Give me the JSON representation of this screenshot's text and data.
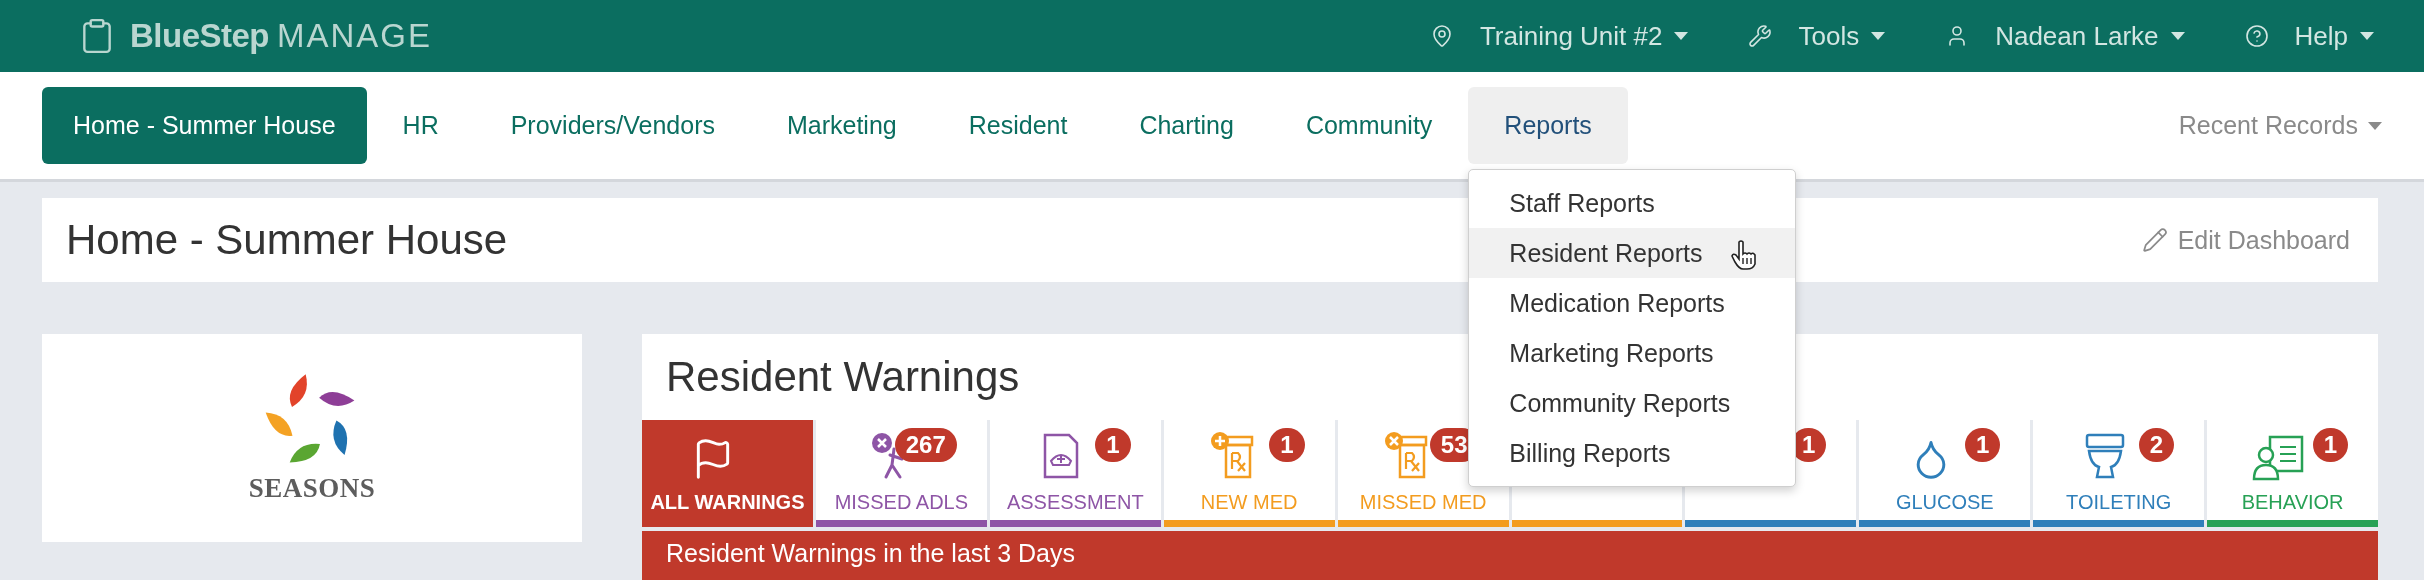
{
  "top_bar": {
    "brand": "BlueStep",
    "product": "MANAGE",
    "menus": [
      {
        "label": "Training Unit #2",
        "kind": "location"
      },
      {
        "label": "Tools",
        "kind": "tools"
      },
      {
        "label": "Nadean Larke",
        "kind": "user"
      },
      {
        "label": "Help",
        "kind": "help"
      }
    ]
  },
  "nav": {
    "tabs": [
      {
        "label": "Home - Summer House",
        "selected": true,
        "open": false
      },
      {
        "label": "HR",
        "selected": false,
        "open": false
      },
      {
        "label": "Providers/Vendors",
        "selected": false,
        "open": false
      },
      {
        "label": "Marketing",
        "selected": false,
        "open": false
      },
      {
        "label": "Resident",
        "selected": false,
        "open": false
      },
      {
        "label": "Charting",
        "selected": false,
        "open": false
      },
      {
        "label": "Community",
        "selected": false,
        "open": false
      },
      {
        "label": "Reports",
        "selected": false,
        "open": true
      }
    ],
    "recent_records": "Recent Records"
  },
  "reports_menu": {
    "items": [
      {
        "label": "Staff Reports",
        "hovered": false
      },
      {
        "label": "Resident Reports",
        "hovered": true
      },
      {
        "label": "Medication Reports",
        "hovered": false
      },
      {
        "label": "Marketing Reports",
        "hovered": false
      },
      {
        "label": "Community Reports",
        "hovered": false
      },
      {
        "label": "Billing Reports",
        "hovered": false
      }
    ]
  },
  "page_header": {
    "title": "Home - Summer House",
    "edit_label": "Edit Dashboard"
  },
  "logo_card": {
    "brand": "SEASONS"
  },
  "warnings": {
    "title": "Resident Warnings",
    "tiles": [
      {
        "label": "ALL WARNINGS",
        "kind": "flag",
        "color": "#c0392b",
        "selected": true
      },
      {
        "label": "MISSED ADLS",
        "kind": "adl",
        "count": "267",
        "color": "#8e55a6",
        "selected": false
      },
      {
        "label": "ASSESSMENT",
        "kind": "document",
        "count": "1",
        "color": "#8e55a6",
        "selected": false
      },
      {
        "label": "NEW MED",
        "kind": "rx_new",
        "count": "1",
        "color": "#f39c1f",
        "selected": false
      },
      {
        "label": "MISSED MED",
        "kind": "rx_missed",
        "count": "53",
        "color": "#f39c1f",
        "selected": false
      },
      {
        "color": "#f39c1f",
        "selected": false
      },
      {
        "count": "1",
        "color": "#2f7fba",
        "selected": false
      },
      {
        "label": "GLUCOSE",
        "kind": "drop",
        "count": "1",
        "color": "#2f7fba",
        "selected": false
      },
      {
        "label": "TOILETING",
        "kind": "toilet",
        "count": "2",
        "color": "#2f7fba",
        "selected": false
      },
      {
        "label": "BEHAVIOR",
        "kind": "person_card",
        "count": "1",
        "color": "#27a155",
        "selected": false
      }
    ],
    "banner": "Resident Warnings in the last 3 Days"
  }
}
